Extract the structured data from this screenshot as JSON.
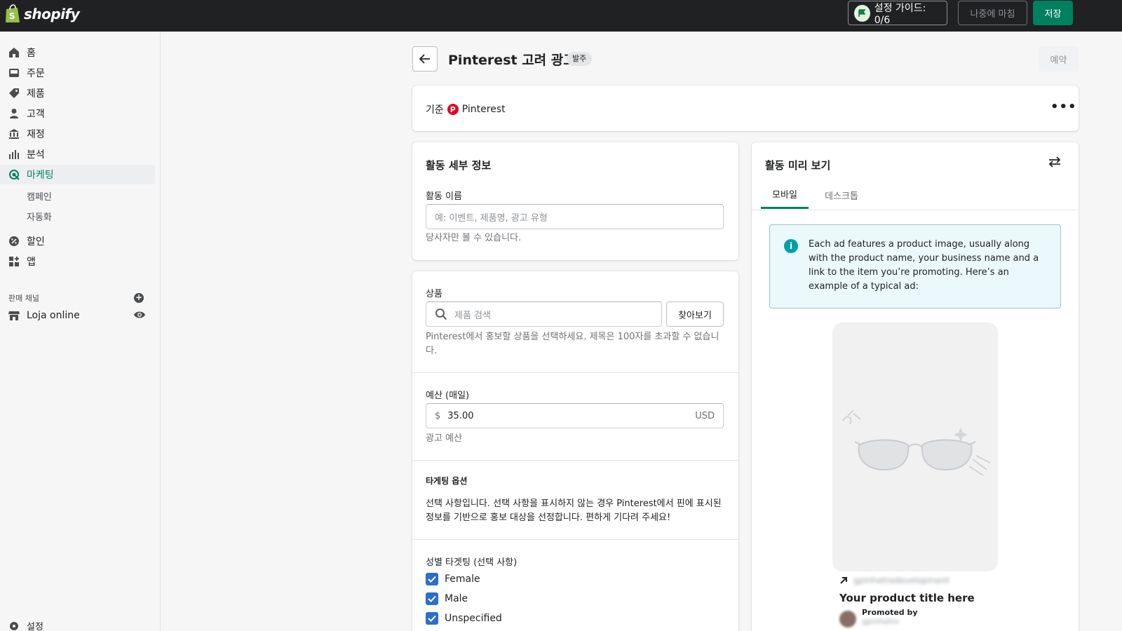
{
  "topbar": {
    "logo_text": "shopify",
    "setup_guide_label": "설정 가이드: 0/6",
    "later_label": "나중에 마침",
    "save_label": "저장"
  },
  "sidebar": {
    "items": [
      {
        "label": "홈",
        "icon": "home-icon"
      },
      {
        "label": "주문",
        "icon": "inbox-icon"
      },
      {
        "label": "제품",
        "icon": "tag-icon"
      },
      {
        "label": "고객",
        "icon": "person-icon"
      },
      {
        "label": "재정",
        "icon": "bank-icon"
      },
      {
        "label": "분석",
        "icon": "bar-chart-icon"
      },
      {
        "label": "마케팅",
        "icon": "target-icon",
        "active": true
      }
    ],
    "sub_items": [
      "캠페인",
      "자동화"
    ],
    "items2": [
      {
        "label": "할인",
        "icon": "discount-icon"
      },
      {
        "label": "앱",
        "icon": "apps-icon"
      }
    ],
    "sales_channels_label": "판매 채널",
    "store_label": "Loja online",
    "bottom_label": "설정"
  },
  "header": {
    "title": "Pinterest 고려 광고",
    "status": "발주",
    "reserve_label": "예약"
  },
  "source": {
    "prefix": "기준",
    "platform": "Pinterest",
    "more_label": "•••"
  },
  "details": {
    "title": "활동 세부 정보",
    "name_label": "활동 이름",
    "name_placeholder": "예: 이벤트, 제품명, 광고 유형",
    "name_help": "당사자만 볼 수 있습니다."
  },
  "form": {
    "product_label": "상품",
    "search_placeholder": "제품 검색",
    "browse_label": "찾아보기",
    "product_help": "Pinterest에서 홍보할 상품을 선택하세요. 제목은 100자를 초과할 수 없습니다.",
    "budget_label": "예산 (매일)",
    "budget_prefix": "$",
    "budget_value": "35.00",
    "budget_currency": "USD",
    "budget_help": "광고 예산",
    "targeting_title": "타게팅 옵션",
    "targeting_text": "선택 사항입니다. 선택 사항을 표시하지 않는 경우 Pinterest에서 핀에 표시된 정보를 기반으로 홍보 대상을 선정합니다. 편하게 기다려 주세요!",
    "gender_label": "성별 타겟팅 (선택 사항)",
    "genders": [
      {
        "label": "Female",
        "checked": true
      },
      {
        "label": "Male",
        "checked": true
      },
      {
        "label": "Unspecified",
        "checked": true
      }
    ]
  },
  "preview": {
    "title": "활동 미리 보기",
    "tabs": [
      {
        "label": "모바일",
        "active": true
      },
      {
        "label": "데스크톱",
        "active": false
      }
    ],
    "info_text": "Each ad features a product image, usually along with the product name, your business name and a link to the item you’re promoting. Here’s an example of a typical ad:",
    "pin_link": "gpinhetrodevelopment",
    "pin_title": "Your product title here",
    "promoted_label": "Promoted by",
    "promoted_name": "gpinhetro"
  },
  "colors": {
    "accent": "#008060",
    "topbar": "#202123",
    "pinterest": "#e60023",
    "checkbox": "#2c6ecb",
    "info_bg": "#ebf9fc"
  }
}
